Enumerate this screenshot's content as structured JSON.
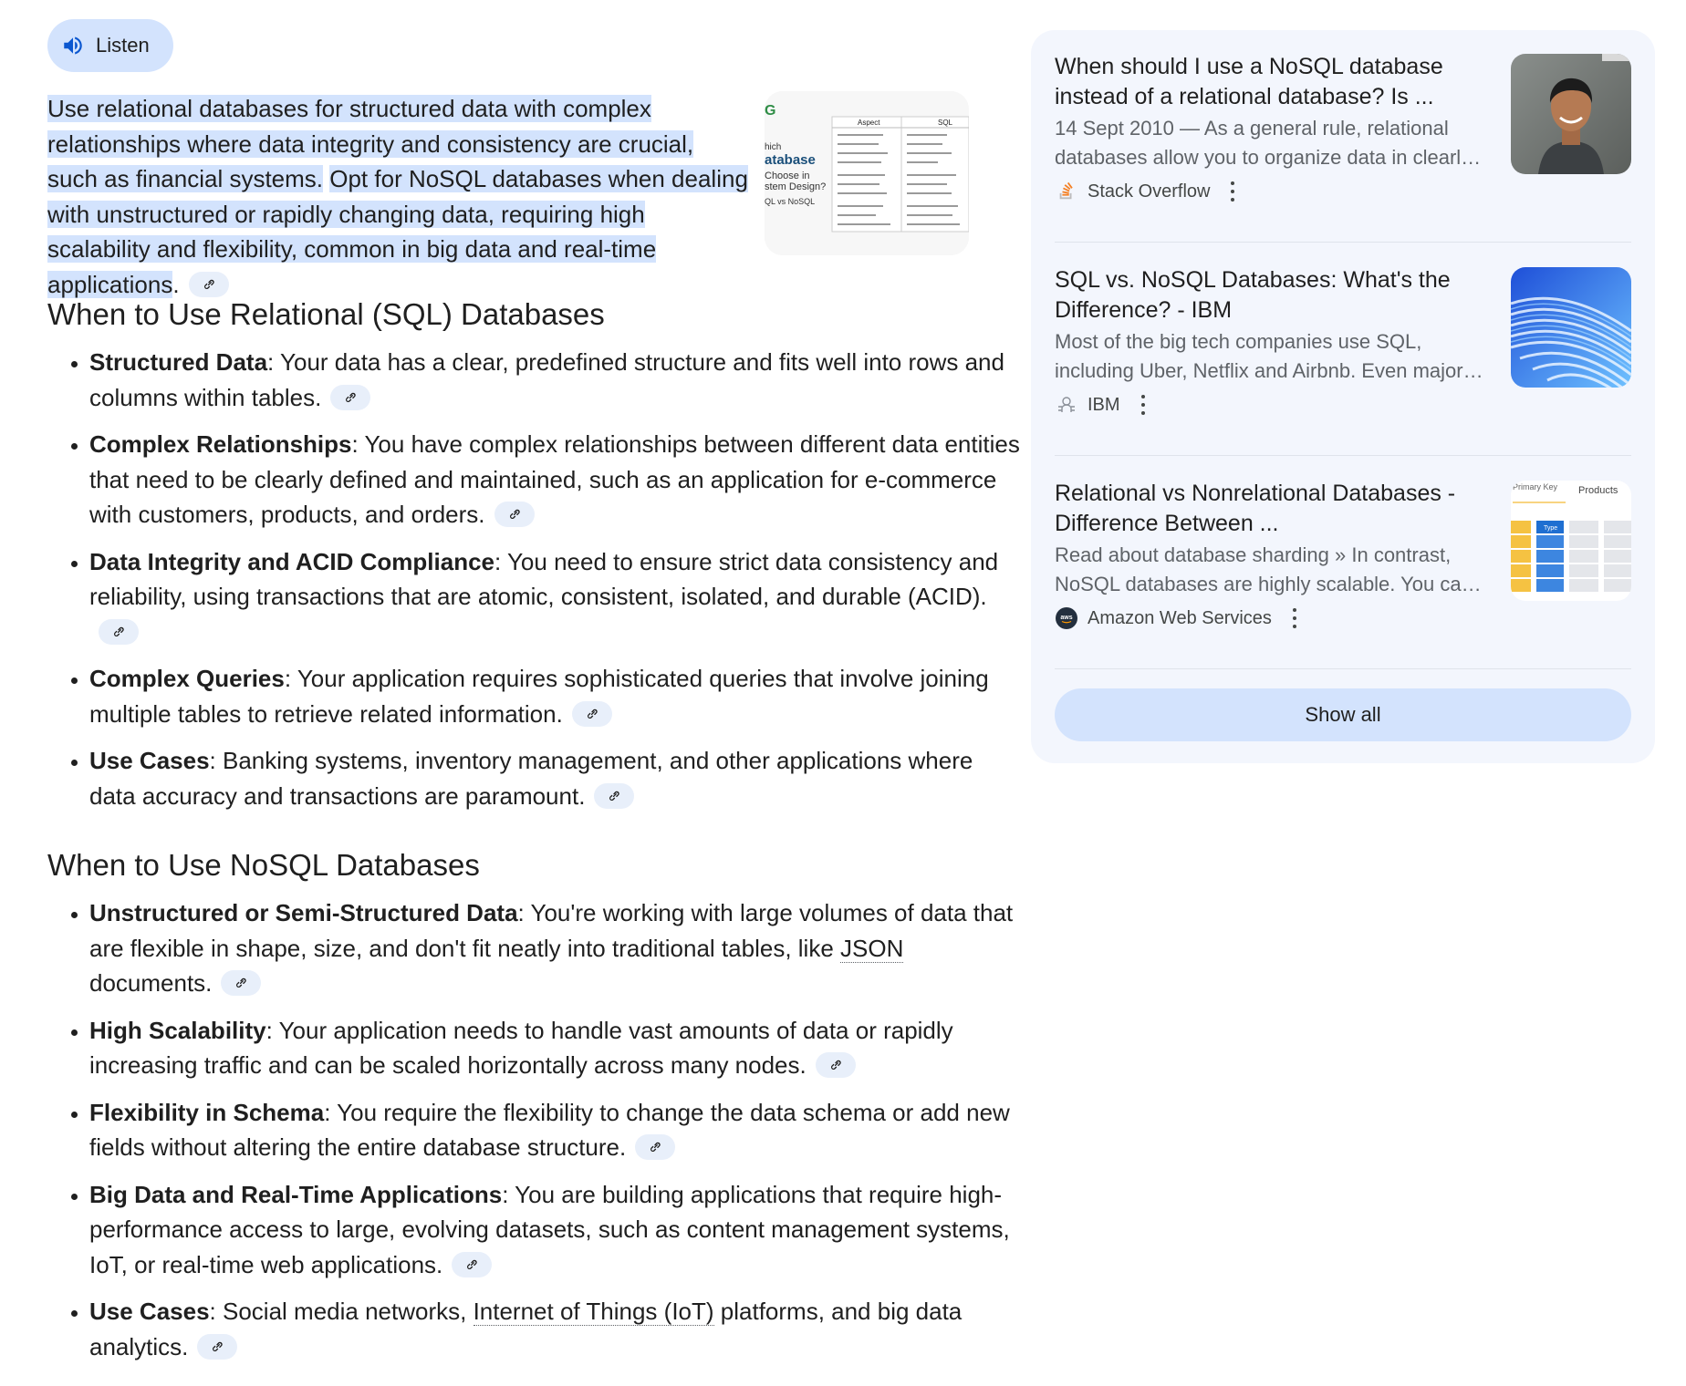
{
  "listen_button": {
    "label": "Listen",
    "icon": "speaker-icon"
  },
  "summary": {
    "part1": "Use relational databases for structured data with complex relationships where data integrity and consistency are crucial, such as financial systems.",
    "part2": "Opt for NoSQL databases when dealing with unstructured or rapidly changing data, requiring high scalability and flexibility, common in big data and real-time applications",
    "end": ".",
    "thumbnail_text": {
      "logo": "G",
      "line1": "hich",
      "line2": "atabase",
      "line3": "Choose in",
      "line4": "stem Design?",
      "line5": "QL vs NoSQL",
      "col1": "Aspect",
      "col2": "SQL"
    }
  },
  "sql_section": {
    "heading": "When to Use Relational (SQL) Databases",
    "items": [
      {
        "term": "Structured Data",
        "text": ": Your data has a clear, predefined structure and fits well into rows and columns within tables."
      },
      {
        "term": "Complex Relationships",
        "text": ": You have complex relationships between different data entities that need to be clearly defined and maintained, such as an application for e-commerce with customers, products, and orders."
      },
      {
        "term": "Data Integrity and ACID Compliance",
        "text": ": You need to ensure strict data consistency and reliability, using transactions that are atomic, consistent, isolated, and durable (ACID)."
      },
      {
        "term": "Complex Queries",
        "text": ": Your application requires sophisticated queries that involve joining multiple tables to retrieve related information."
      },
      {
        "term": "Use Cases",
        "text": ": Banking systems, inventory management, and other applications where data accuracy and transactions are paramount."
      }
    ]
  },
  "nosql_section": {
    "heading": "When to Use NoSQL Databases",
    "items": [
      {
        "term": "Unstructured or Semi-Structured Data",
        "text_before": ": You're working with large volumes of data that are flexible in shape, size, and don't fit neatly into traditional tables, like ",
        "link": "JSON",
        "text_after": " documents."
      },
      {
        "term": "High Scalability",
        "text": ": Your application needs to handle vast amounts of data or rapidly increasing traffic and can be scaled horizontally across many nodes."
      },
      {
        "term": "Flexibility in Schema",
        "text": ": You require the flexibility to change the data schema or add new fields without altering the entire database structure."
      },
      {
        "term": "Big Data and Real-Time Applications",
        "text": ": You are building applications that require high-performance access to large, evolving datasets, such as content management systems, IoT, or real-time web applications."
      },
      {
        "term": "Use Cases",
        "text_before": ": Social media networks, ",
        "link": "Internet of Things (IoT)",
        "text_after": " platforms, and big data analytics."
      }
    ]
  },
  "sources": [
    {
      "title": "When should I use a NoSQL database instead of a relational database? Is ...",
      "snippet1": "14 Sept 2010 — As a general rule, relational",
      "snippet2": "databases allow you to organize data in clearl…",
      "source": "Stack Overflow",
      "icon": "stack-overflow-icon"
    },
    {
      "title": "SQL vs. NoSQL Databases: What's the Difference? - IBM",
      "snippet1": "Most of the big tech companies use SQL,",
      "snippet2": "including Uber, Netflix and Airbnb. Even major…",
      "source": "IBM",
      "icon": "ibm-icon"
    },
    {
      "title": "Relational vs Nonrelational Databases - Difference Between ...",
      "snippet1": "Read about database sharding » In contrast,",
      "snippet2": "NoSQL databases are highly scalable. You ca…",
      "source": "Amazon Web Services",
      "icon": "aws-icon",
      "thumb_text": {
        "a": "Primary Key",
        "b": "Products",
        "c": "Type"
      }
    }
  ],
  "show_all_label": "Show all",
  "colors": {
    "highlight": "#d3e3fd",
    "panel_bg": "#f3f6fd",
    "chip_bg": "#e8effa",
    "accent": "#0b57d0"
  }
}
